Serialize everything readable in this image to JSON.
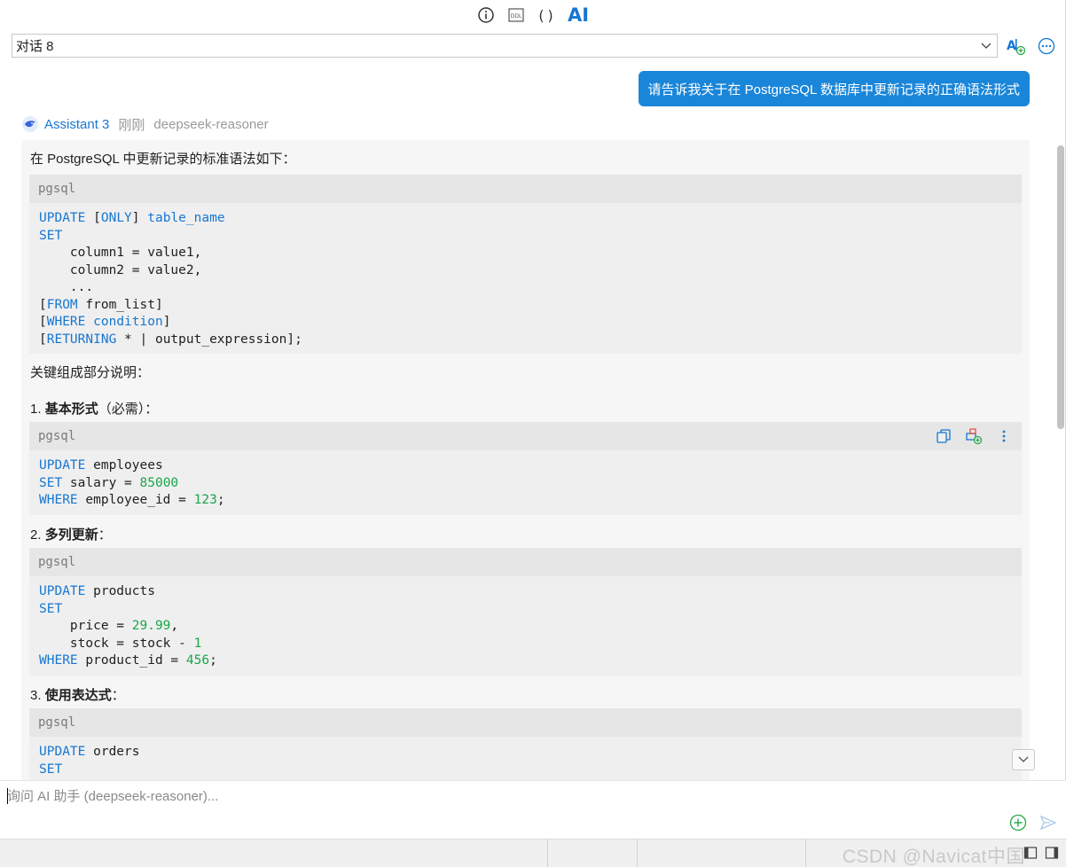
{
  "toolbar": {
    "tabs": [
      {
        "name": "info-icon"
      },
      {
        "name": "ddl-icon",
        "label": "DDL"
      },
      {
        "name": "parentheses-icon",
        "label": "()"
      },
      {
        "name": "ai-icon",
        "label": "AI"
      }
    ]
  },
  "conversation": {
    "selected": "对话 8",
    "new_chat_icon": "ai-new-chat-icon",
    "more_icon": "more-options-icon"
  },
  "chat": {
    "user_message": "请告诉我关于在 PostgreSQL 数据库中更新记录的正确语法形式",
    "assistant": {
      "name": "Assistant 3",
      "time": "刚刚",
      "model": "deepseek-reasoner"
    },
    "answer": {
      "intro": "在 PostgreSQL 中更新记录的标准语法如下：",
      "code1_lang": "pgsql",
      "section_title": "关键组成部分说明：",
      "item1_num": "1. ",
      "item1_bold": "基本形式",
      "item1_rest": "（必需）：",
      "code2_lang": "pgsql",
      "item2_num": "2. ",
      "item2_bold": "多列更新",
      "item2_rest": "：",
      "code3_lang": "pgsql",
      "item3_num": "3. ",
      "item3_bold": "使用表达式",
      "item3_rest": "：",
      "code4_lang": "pgsql"
    }
  },
  "input": {
    "placeholder": "询问 AI 助手 (deepseek-reasoner)..."
  },
  "statusbar": {
    "watermark": "CSDN @Navicat中国"
  },
  "colors": {
    "accent": "#1677d2",
    "user_bubble": "#1a86d9",
    "number": "#1aa64a",
    "code_bg": "#efefef"
  }
}
